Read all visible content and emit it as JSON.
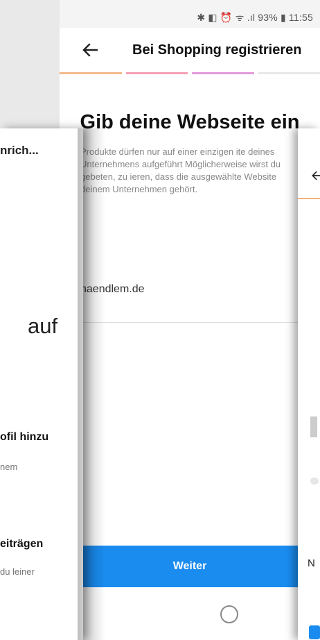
{
  "status_bar": {
    "text": "✱ ◧ ⏰ ᯤ .ıl 93% ▮ 11:55"
  },
  "app_bar": {
    "back_icon": "arrow-left-icon",
    "title": "Bei Shopping registrieren"
  },
  "progress_colors": [
    "#f5b98a",
    "#f5a0b5",
    "#e39bdc",
    "#e8e8e8"
  ],
  "main": {
    "heading": "Gib deine Webseite ein",
    "description": "Produkte dürfen nur auf einer einzigen ite deines Unternehmens aufgeführt Möglicherweise wirst du gebeten, zu ieren, dass die ausgewählte Website deinem Unternehmen gehört.",
    "website_value": "haendlem.de",
    "continue_label": "Weiter"
  },
  "left_panel": {
    "top_text": "nrich...",
    "large_text": "auf",
    "item1_title": "ofil hinzu",
    "item1_sub": "nem",
    "item2_title": "eiträgen",
    "item2_sub": "du leiner"
  },
  "right_panel": {
    "letter": "N"
  },
  "nav": {
    "back_icon": "nav-back-icon",
    "home_icon": "nav-home-icon",
    "recent_icon": "nav-recent-icon"
  },
  "accent_color": "#1a8cf0"
}
